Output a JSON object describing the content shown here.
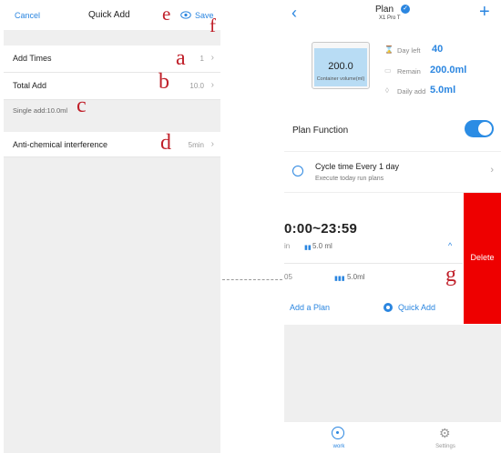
{
  "quick_add": {
    "cancel_label": "Cancel",
    "title": "Quick Add",
    "save_label": "Save",
    "add_times": {
      "label": "Add Times",
      "value": "1"
    },
    "total_add": {
      "label": "Total Add",
      "value": "10.0"
    },
    "single_add": "Single add:10.0ml",
    "anti_chem": {
      "label": "Anti-chemical interference",
      "value": "5min"
    }
  },
  "annotations": {
    "a": "a",
    "b": "b",
    "c": "c",
    "d": "d",
    "e": "e",
    "f": "f",
    "g": "g"
  },
  "plan": {
    "title": "Plan",
    "subtitle": "X1 Pro T",
    "container": {
      "value": "200.0",
      "label": "Container volume(ml)"
    },
    "stats": {
      "day_left": {
        "label": "Day left",
        "value": "40"
      },
      "remain": {
        "label": "Remain",
        "value": "200.0ml"
      },
      "daily_add": {
        "label": "Daily add",
        "value": "5.0ml"
      }
    },
    "plan_function_label": "Plan Function",
    "plan_function_on": true,
    "cycle": {
      "title": "Cycle time  Every 1 day",
      "desc": "Execute today run plans"
    },
    "plan_item": {
      "time": "0:00~23:59",
      "sub": "in",
      "volume": "5.0 ml",
      "sub2": "05",
      "volume2": "5.0ml"
    },
    "delete_label": "Delete",
    "add_plan_label": "Add a Plan",
    "quick_add_label": "Quick Add",
    "tabs": {
      "work": "work",
      "settings": "Settings"
    }
  },
  "colors": {
    "accent": "#2b86e0",
    "delete": "#ee0000",
    "annotation": "#c0202a"
  }
}
